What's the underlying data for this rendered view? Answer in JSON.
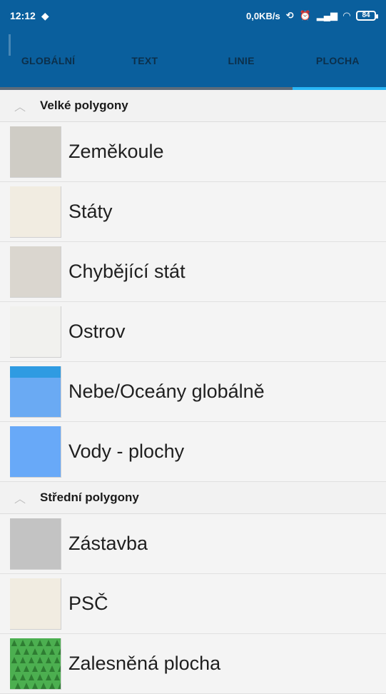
{
  "status_bar": {
    "time": "12:12",
    "network_speed": "0,0KB/s",
    "battery": "84"
  },
  "tabs": [
    {
      "label": "GLOBÁLNÍ",
      "active": false
    },
    {
      "label": "TEXT",
      "active": false
    },
    {
      "label": "LINIE",
      "active": false
    },
    {
      "label": "PLOCHA",
      "active": true
    }
  ],
  "sections": [
    {
      "title": "Velké polygony",
      "items": [
        {
          "label": "Zeměkoule",
          "color": "#cfccc5"
        },
        {
          "label": "Státy",
          "color": "#f1ece1"
        },
        {
          "label": "Chybějící stát",
          "color": "#dad6cf"
        },
        {
          "label": "Ostrov",
          "color": "#f1f1ee"
        },
        {
          "label": "Nebe/Oceány globálně",
          "color": "#6aaaf3",
          "band_color": "#2f9be2"
        },
        {
          "label": "Vody - plochy",
          "color": "#68a9f8"
        }
      ]
    },
    {
      "title": "Střední polygony",
      "items": [
        {
          "label": "Zástavba",
          "color": "#c3c3c3"
        },
        {
          "label": "PSČ",
          "color": "#f1ece1"
        },
        {
          "label": "Zalesněná plocha",
          "color": "#4caf50",
          "pattern": "trees"
        }
      ]
    }
  ]
}
